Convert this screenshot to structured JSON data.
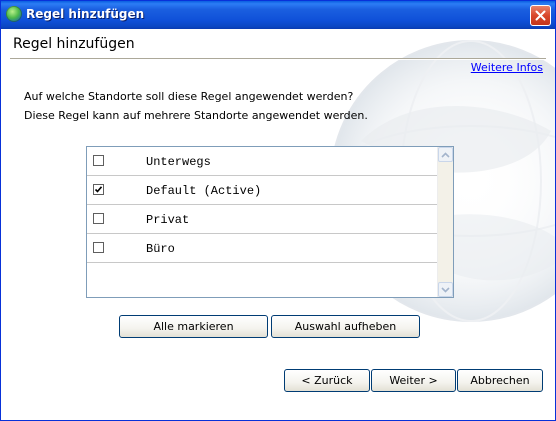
{
  "window": {
    "title": "Regel hinzufügen",
    "icon": "globe-icon",
    "close_icon": "close-icon",
    "close_color": "#d9472b",
    "titlebar_color": "#0f50d8"
  },
  "header": {
    "title": "Regel hinzufügen",
    "info_link": "Weitere Infos"
  },
  "description": {
    "line1": "Auf welche Standorte soll diese Regel angewendet werden?",
    "line2": "Diese Regel kann auf mehrere Standorte angewendet werden."
  },
  "locations": [
    {
      "label": "Unterwegs",
      "checked": false
    },
    {
      "label": "Default (Active)",
      "checked": true
    },
    {
      "label": "Privat",
      "checked": false
    },
    {
      "label": "Büro",
      "checked": false
    }
  ],
  "buttons": {
    "mark_all": "Alle markieren",
    "clear_selection": "Auswahl aufheben",
    "back": "< Zurück",
    "next": "Weiter >",
    "cancel": "Abbrechen"
  }
}
